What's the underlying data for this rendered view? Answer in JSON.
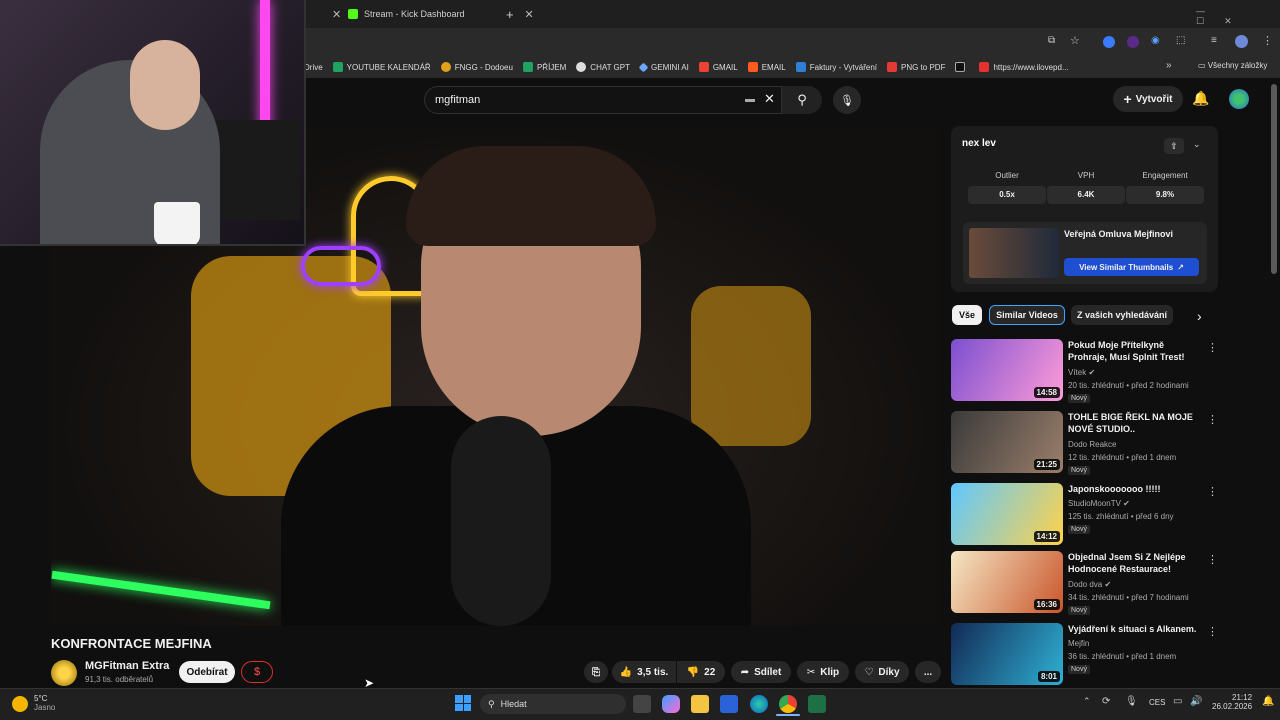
{
  "browser": {
    "tabs": [
      {
        "label": "Stream - Kick Dashboard"
      }
    ],
    "bookmarks": [
      {
        "label": "Drive"
      },
      {
        "label": "YOUTUBE KALENDÁŘ"
      },
      {
        "label": "FNGG - Dodoeu"
      },
      {
        "label": "PŘÍJEM"
      },
      {
        "label": "CHAT GPT"
      },
      {
        "label": "GEMINI AI"
      },
      {
        "label": "GMAIL"
      },
      {
        "label": "EMAIL"
      },
      {
        "label": "Faktury - Vytváření"
      },
      {
        "label": "PNG to PDF"
      },
      {
        "label": "https://www.ilovepd..."
      }
    ],
    "all_bookmarks": "Všechny záložky"
  },
  "youtube": {
    "search_value": "mgfitman",
    "create_label": "Vytvořit",
    "video_title": "KONFRONTACE MEJFINA",
    "channel": {
      "name": "MGFitman Extra",
      "subs": "91,3 tis. odběratelů"
    },
    "subscribe_label": "Odebírat",
    "dollar_label": "$",
    "actions": {
      "likes": "3,5 tis.",
      "dislikes": "22",
      "share": "Sdílet",
      "clip": "Klip",
      "thanks": "Díky",
      "more": "..."
    }
  },
  "extension": {
    "logo": "nex lev",
    "stats": [
      {
        "label": "Outlier",
        "value": "0.5x"
      },
      {
        "label": "VPH",
        "value": "6.4K"
      },
      {
        "label": "Engagement",
        "value": "9.8%"
      }
    ],
    "similar_title": "Veřejná Omluva Mejfinovi",
    "view_similar": "View Similar Thumbnails"
  },
  "chips": [
    "Vše",
    "Similar Videos",
    "Z vašich vyhledávání"
  ],
  "related": [
    {
      "title": "Pokud Moje Přítelkyně Prohraje, Musí Splnit Trest!",
      "channel": "Vítek",
      "meta": "20 tis. zhlédnutí • před 2 hodinami",
      "badge": "Nový",
      "duration": "14:58",
      "colors": [
        "#7b4fd0",
        "#ff9cd8"
      ]
    },
    {
      "title": "TOHLE BIGE ŘEKL NA MOJE NOVÉ STUDIO..",
      "channel": "Dodo Reakce",
      "meta": "12 tis. zhlédnutí • před 1 dnem",
      "badge": "Nový",
      "duration": "21:25",
      "colors": [
        "#3a3a3a",
        "#9b7f6b"
      ]
    },
    {
      "title": "Japonskooooooo !!!!!",
      "channel": "StudioMoonTV",
      "meta": "125 tis. zhlédnutí • před 6 dny",
      "badge": "Nový",
      "duration": "14:12",
      "colors": [
        "#5fc8ff",
        "#ffd24a"
      ]
    },
    {
      "title": "Objednal Jsem Si Z Nejlépe Hodnocené Restaurace!",
      "channel": "Dodo dva",
      "meta": "34 tis. zhlédnutí • před 7 hodinami",
      "badge": "Nový",
      "duration": "16:36",
      "colors": [
        "#f5e7c4",
        "#c9552b"
      ]
    },
    {
      "title": "Vyjádření k situaci s Alkanem.",
      "channel": "Mejfin",
      "meta": "36 tis. zhlédnutí • před 1 dnem",
      "badge": "Nový",
      "duration": "8:01",
      "colors": [
        "#122a55",
        "#2fb0d4"
      ]
    }
  ],
  "taskbar": {
    "weather_temp": "5°C",
    "weather_text": "Jasno",
    "search_placeholder": "Hledat",
    "lang": "CES",
    "time": "21:12",
    "date": "26.02.2026"
  }
}
